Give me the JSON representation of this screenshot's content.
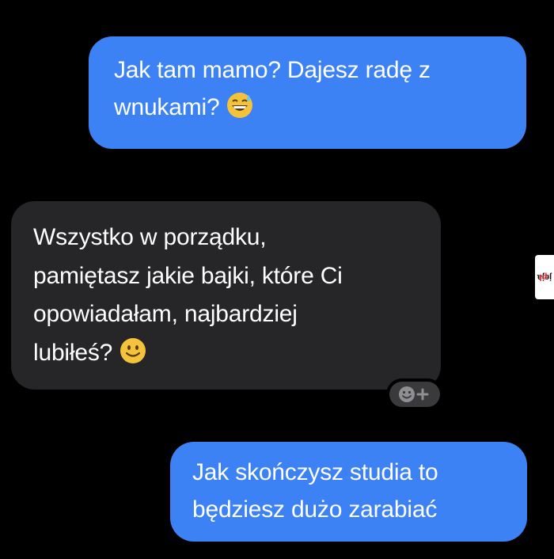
{
  "messages": [
    {
      "sender": "me",
      "lines": [
        "Jak tam mamo? Dajesz radę z",
        "wnukami?"
      ],
      "emoji": "grinning-sweat-emoji"
    },
    {
      "sender": "mom",
      "lines": [
        "Wszystko w porządku,",
        "pamiętasz jakie bajki, które Ci",
        "opowiadałam, najbardziej",
        "lubiłeś?"
      ],
      "emoji": "slightly-smiling-emoji"
    },
    {
      "sender": "me",
      "lines": [
        "Jak skończysz studia to",
        "będziesz dużo zarabiać"
      ]
    }
  ],
  "watermark": {
    "brand": "jeja",
    "suffix": ".pl"
  },
  "colors": {
    "background": "#000000",
    "sent_bubble": "#3d82f4",
    "received_bubble": "#262628",
    "text": "#ffffff"
  }
}
